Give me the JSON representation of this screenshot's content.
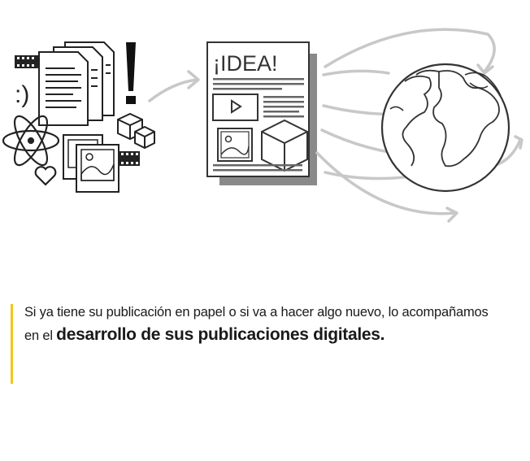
{
  "illustration": {
    "poster_heading": "¡IDEA!",
    "emoticon": ":)",
    "exclamation": "!",
    "icons": [
      "film-strip-icon",
      "documents-icon",
      "smiley-icon",
      "exclamation-icon",
      "atom-icon",
      "heart-icon",
      "photos-icon",
      "cubes-icon",
      "arrow-icon",
      "poster-icon",
      "play-icon",
      "image-icon",
      "cube-icon",
      "globe-icon",
      "orbit-arrows-icon"
    ],
    "colors": {
      "stroke": "#333333",
      "shadow": "#8a8a8a",
      "arrow": "#c8c8c8",
      "accent": "#f5c518"
    }
  },
  "text": {
    "line1": "Si ya tiene su publicación en papel o si va a hacer algo nuevo, lo acompañamos",
    "line2_prefix": "en el ",
    "line2_strong": "desarrollo de sus publicaciones digitales."
  }
}
